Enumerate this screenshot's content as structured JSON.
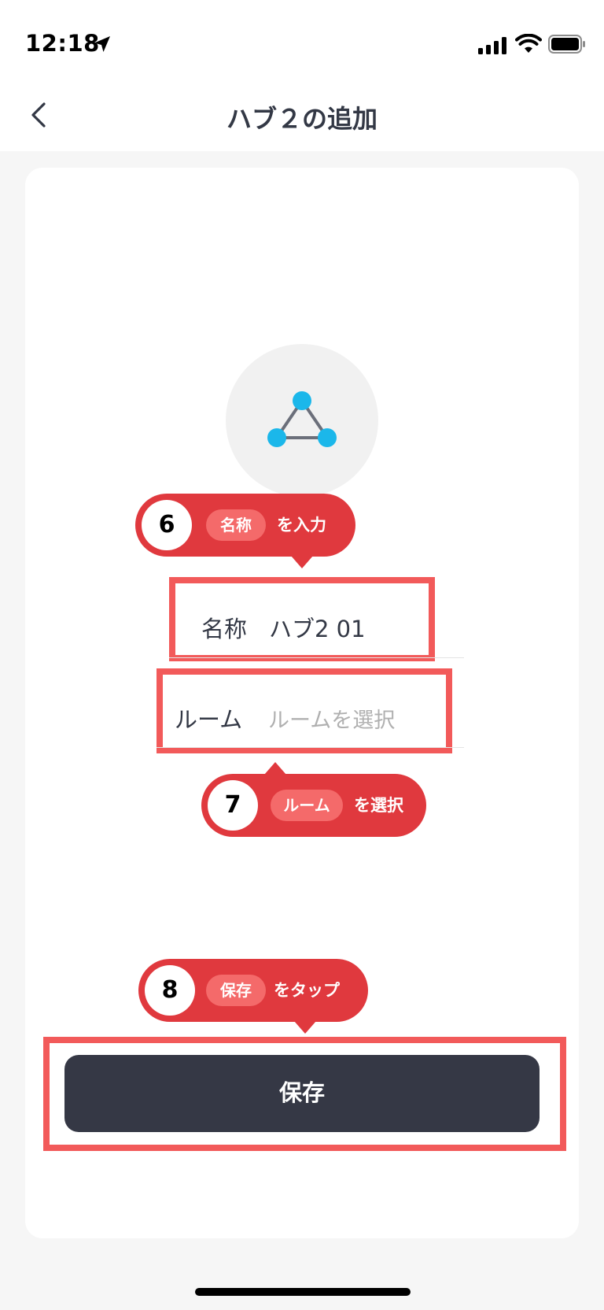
{
  "status_bar": {
    "time": "12:18"
  },
  "nav": {
    "title": "ハブ２の追加"
  },
  "form": {
    "name_label": "名称",
    "name_value": "ハブ2 01",
    "room_label": "ルーム",
    "room_placeholder": "ルームを選択"
  },
  "callouts": [
    {
      "number": "6",
      "chip": "名称",
      "action": "を入力"
    },
    {
      "number": "7",
      "chip": "ルーム",
      "action": "を選択"
    },
    {
      "number": "8",
      "chip": "保存",
      "action": "をタップ"
    }
  ],
  "save_button": {
    "label": "保存"
  },
  "colors": {
    "accent_blue": "#1bb7ea",
    "annotation_red": "#e0393e",
    "button_dark": "#353845"
  }
}
